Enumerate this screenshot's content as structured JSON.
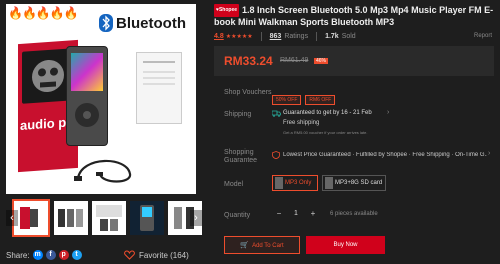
{
  "gallery": {
    "emojis": [
      "🔥",
      "🔥",
      "🔥",
      "🔥",
      "🔥"
    ],
    "bluetooth_label": "Bluetooth",
    "device_label": "audio play",
    "prev_arrow": "‹",
    "next_arrow": "›"
  },
  "share": {
    "label": "Share:"
  },
  "favorite": {
    "label": "Favorite (164)"
  },
  "product": {
    "badge": "♥Shopee",
    "title": "1.8 Inch Screen Bluetooth 5.0 Mp3 Mp4 Music Player FM E-book Mini Walkman Sports Bluetooth MP3",
    "rating": "4.8",
    "stars": "★★★★★",
    "ratings_count": "863",
    "ratings_label": "Ratings",
    "sold_count": "1.7k",
    "sold_label": "Sold",
    "report_label": "Report",
    "price": "RM33.24",
    "original_price": "RM61.49",
    "discount": "46%"
  },
  "vouchers": {
    "label": "Shop Vouchers",
    "items": [
      "50% OFF",
      "RM6 OFF"
    ]
  },
  "shipping": {
    "label": "Shipping",
    "guarantee": "Guaranteed to get by 16 - 21 Feb",
    "free_shipping": "Free shipping",
    "voucher_note": "Get a RM5.00 voucher if your order arrives late."
  },
  "guarantee": {
    "label": "Shopping Guarantee",
    "text": "Lowest Price Guaranteed · Fulfilled by Shopee · Free Shipping · On-Time G..."
  },
  "model": {
    "label": "Model",
    "options": [
      "MP3 Only",
      "MP3+8G SD card"
    ]
  },
  "quantity": {
    "label": "Quantity",
    "value": "1",
    "minus": "−",
    "plus": "+",
    "available": "6 pieces available"
  },
  "actions": {
    "add_to_cart": "Add To Cart",
    "buy_now": "Buy Now"
  },
  "colors": {
    "accent": "#ee4d2d",
    "buy_now_bg": "#d0011b",
    "background": "#1e1e1e"
  }
}
